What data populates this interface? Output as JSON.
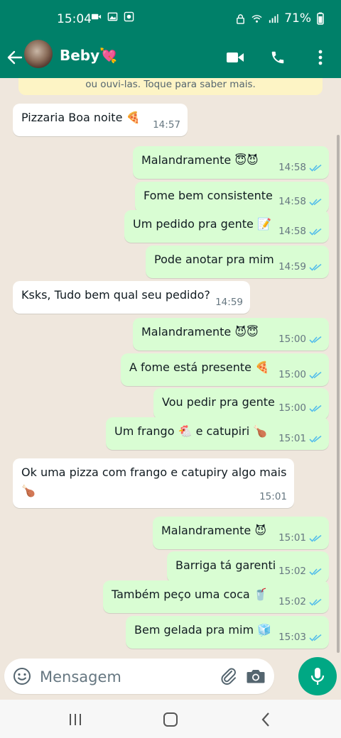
{
  "status_bar": {
    "time": "15:04",
    "battery": "71%",
    "icons_left": [
      "video-icon",
      "image-icon",
      "record-icon"
    ],
    "icons_right": [
      "lock-icon",
      "wifi-icon",
      "signal-icon",
      "battery-icon"
    ]
  },
  "header": {
    "contact_name": "Beby💘",
    "actions": [
      "video-call-icon",
      "phone-icon",
      "more-icon"
    ]
  },
  "chat": {
    "notice": "ou ouvi-las. Toque para saber mais.",
    "messages": [
      {
        "dir": "in",
        "text": "Pizzaria Boa noite 🍕",
        "time": "14:57"
      },
      {
        "dir": "out",
        "text": "Malandramente 😇😈",
        "time": "14:58"
      },
      {
        "dir": "out",
        "text": "Fome bem consistente",
        "time": "14:58"
      },
      {
        "dir": "out",
        "text": "Um pedido pra gente 📝",
        "time": "14:58"
      },
      {
        "dir": "out",
        "text": "Pode anotar pra mim",
        "time": "14:59"
      },
      {
        "dir": "in",
        "text": "Ksks, Tudo bem qual seu pedido?",
        "time": "14:59"
      },
      {
        "dir": "out",
        "text": "Malandramente 😈😇",
        "time": "15:00"
      },
      {
        "dir": "out",
        "text": "A fome está presente 🍕",
        "time": "15:00"
      },
      {
        "dir": "out",
        "text": "Vou pedir pra gente",
        "time": "15:00"
      },
      {
        "dir": "out",
        "text": "Um frango 🐔 e catupiri 🍗",
        "time": "15:01"
      },
      {
        "dir": "in",
        "text": "Ok uma pizza com frango e catupiry algo mais",
        "text2": "🍗",
        "time": "15:01"
      },
      {
        "dir": "out",
        "text": "Malandramente 😈",
        "time": "15:01"
      },
      {
        "dir": "out",
        "text": "Barriga tá garenti",
        "time": "15:02"
      },
      {
        "dir": "out",
        "text": "Também peço uma coca 🥤",
        "time": "15:02"
      },
      {
        "dir": "out",
        "text": "Bem gelada pra mim 🧊",
        "time": "15:03"
      }
    ]
  },
  "composer": {
    "placeholder": "Mensagem"
  },
  "colors": {
    "header": "#008069",
    "outgoing": "#d9fdd3",
    "incoming": "#ffffff",
    "ticks": "#53bdeb",
    "mic": "#00a884"
  }
}
